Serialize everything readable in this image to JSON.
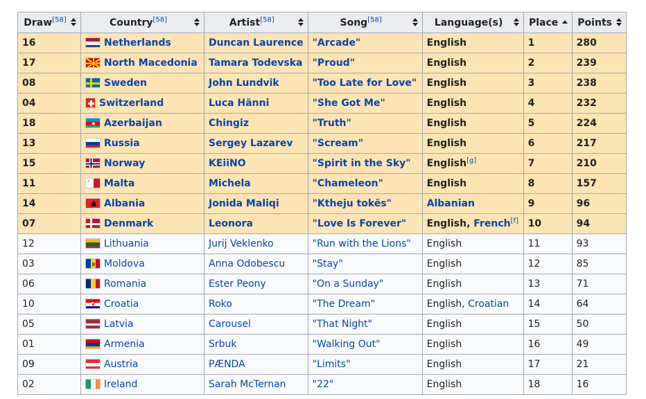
{
  "top_partial_text": "",
  "headers": {
    "draw": "Draw",
    "draw_ref": "[58]",
    "country": "Country",
    "country_ref": "[58]",
    "artist": "Artist",
    "artist_ref": "[58]",
    "song": "Song",
    "song_ref": "[58]",
    "language": "Language(s)",
    "place": "Place",
    "points": "Points"
  },
  "rows": [
    {
      "draw": "16",
      "country": "Netherlands",
      "flag": "netherlands",
      "artist": "Duncan Laurence",
      "song": "\"Arcade\"",
      "lang": "English",
      "lang2": "",
      "ref": "",
      "place": "1",
      "points": "280",
      "q": true
    },
    {
      "draw": "17",
      "country": "North Macedonia",
      "flag": "macedonia",
      "artist": "Tamara Todevska",
      "song": "\"Proud\"",
      "lang": "English",
      "lang2": "",
      "ref": "",
      "place": "2",
      "points": "239",
      "q": true
    },
    {
      "draw": "08",
      "country": "Sweden",
      "flag": "sweden",
      "artist": "John Lundvik",
      "song": "\"Too Late for Love\"",
      "lang": "English",
      "lang2": "",
      "ref": "",
      "place": "3",
      "points": "238",
      "q": true
    },
    {
      "draw": "04",
      "country": "Switzerland",
      "flag": "switzerland",
      "artist": "Luca Hänni",
      "song": "\"She Got Me\"",
      "lang": "English",
      "lang2": "",
      "ref": "",
      "place": "4",
      "points": "232",
      "q": true
    },
    {
      "draw": "18",
      "country": "Azerbaijan",
      "flag": "azerbaijan",
      "artist": "Chingiz",
      "song": "\"Truth\"",
      "lang": "English",
      "lang2": "",
      "ref": "",
      "place": "5",
      "points": "224",
      "q": true
    },
    {
      "draw": "13",
      "country": "Russia",
      "flag": "russia",
      "artist": "Sergey Lazarev",
      "song": "\"Scream\"",
      "lang": "English",
      "lang2": "",
      "ref": "",
      "place": "6",
      "points": "217",
      "q": true
    },
    {
      "draw": "15",
      "country": "Norway",
      "flag": "norway",
      "artist": "KEiiNO",
      "song": "\"Spirit in the Sky\"",
      "lang": "English",
      "lang2": "",
      "ref": "[g]",
      "place": "7",
      "points": "210",
      "q": true
    },
    {
      "draw": "11",
      "country": "Malta",
      "flag": "malta",
      "artist": "Michela",
      "song": "\"Chameleon\"",
      "lang": "English",
      "lang2": "",
      "ref": "",
      "place": "8",
      "points": "157",
      "q": true
    },
    {
      "draw": "14",
      "country": "Albania",
      "flag": "albania",
      "artist": "Jonida Maliqi",
      "song": "\"Ktheju tokës\"",
      "lang": "Albanian",
      "lang2": "",
      "ref": "",
      "place": "9",
      "points": "96",
      "q": true,
      "lang_link": true
    },
    {
      "draw": "07",
      "country": "Denmark",
      "flag": "denmark",
      "artist": "Leonora",
      "song": "\"Love Is Forever\"",
      "lang": "English, ",
      "lang2": "French",
      "ref": "[f]",
      "place": "10",
      "points": "94",
      "q": true
    },
    {
      "draw": "12",
      "country": "Lithuania",
      "flag": "lithuania",
      "artist": "Jurij Veklenko",
      "song": "\"Run with the Lions\"",
      "lang": "English",
      "lang2": "",
      "ref": "",
      "place": "11",
      "points": "93",
      "q": false
    },
    {
      "draw": "03",
      "country": "Moldova",
      "flag": "moldova",
      "artist": "Anna Odobescu",
      "song": "\"Stay\"",
      "lang": "English",
      "lang2": "",
      "ref": "",
      "place": "12",
      "points": "85",
      "q": false
    },
    {
      "draw": "06",
      "country": "Romania",
      "flag": "romania",
      "artist": "Ester Peony",
      "song": "\"On a Sunday\"",
      "lang": "English",
      "lang2": "",
      "ref": "",
      "place": "13",
      "points": "71",
      "q": false
    },
    {
      "draw": "10",
      "country": "Croatia",
      "flag": "croatia",
      "artist": "Roko",
      "song": "\"The Dream\"",
      "lang": "English, ",
      "lang2": "Croatian",
      "ref": "",
      "place": "14",
      "points": "64",
      "q": false
    },
    {
      "draw": "05",
      "country": "Latvia",
      "flag": "latvia",
      "artist": "Carousel",
      "song": "\"That Night\"",
      "lang": "English",
      "lang2": "",
      "ref": "",
      "place": "15",
      "points": "50",
      "q": false
    },
    {
      "draw": "01",
      "country": "Armenia",
      "flag": "armenia",
      "artist": "Srbuk",
      "song": "\"Walking Out\"",
      "lang": "English",
      "lang2": "",
      "ref": "",
      "place": "16",
      "points": "49",
      "q": false
    },
    {
      "draw": "09",
      "country": "Austria",
      "flag": "austria",
      "artist": "PÆNDA",
      "song": "\"Limits\"",
      "lang": "English",
      "lang2": "",
      "ref": "",
      "place": "17",
      "points": "21",
      "q": false
    },
    {
      "draw": "02",
      "country": "Ireland",
      "flag": "ireland",
      "artist": "Sarah McTernan",
      "song": "\"22\"",
      "lang": "English",
      "lang2": "",
      "ref": "",
      "place": "18",
      "points": "16",
      "q": false
    }
  ],
  "colors": {
    "qualified_row": "#fce4b4",
    "link": "#0645ad",
    "header": "#eaecf0",
    "border": "#a2a9b1"
  }
}
